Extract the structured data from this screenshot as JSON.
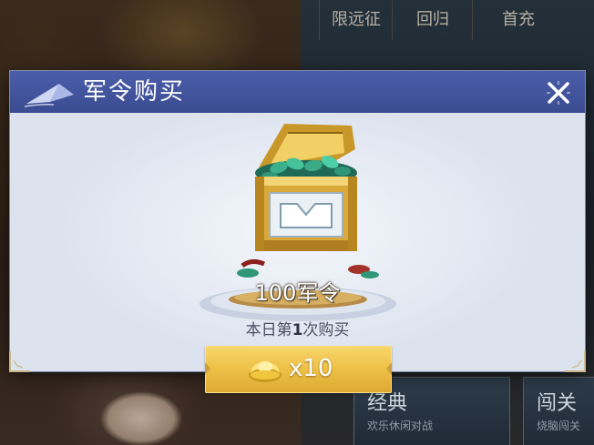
{
  "background": {
    "nav_items": [
      "限远征",
      "回归",
      "首充"
    ],
    "cards": [
      {
        "title": "经典",
        "subtitle": "欢乐休闲对战"
      },
      {
        "title": "闯关",
        "subtitle": "烧脑闯关"
      }
    ]
  },
  "dialog": {
    "title": "军令购买",
    "reward_label": "100军令",
    "purchase_prefix": "本日第",
    "purchase_count": "1",
    "purchase_suffix": "次购买",
    "price": "x10",
    "currency_icon": "gold-ingot-icon",
    "close_icon": "close-icon"
  },
  "colors": {
    "header": "#4a5da8",
    "button": "#eec046",
    "body": "#e6ebf4"
  }
}
